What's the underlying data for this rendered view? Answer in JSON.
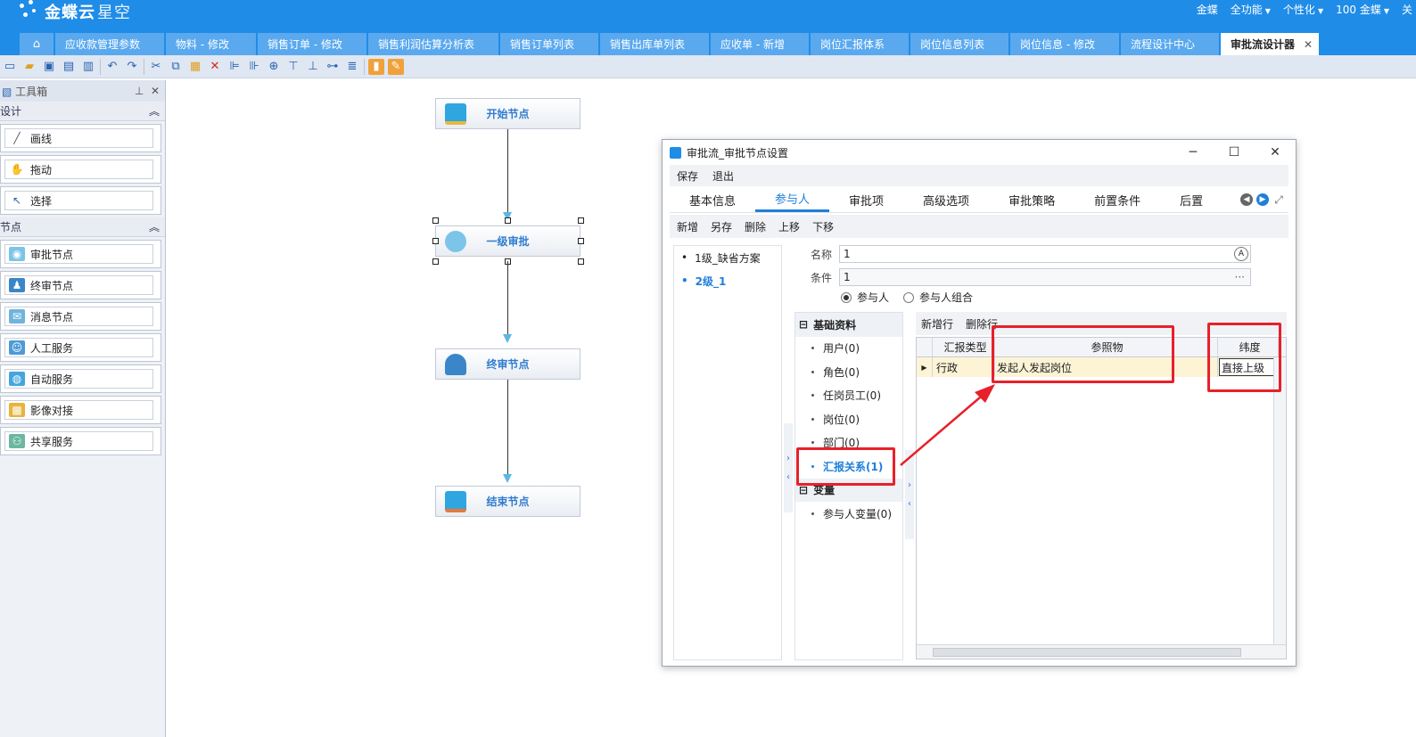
{
  "header": {
    "logo_text": "金蝶云",
    "logo_sub": "星空",
    "right_items": [
      "金蝶",
      "全功能",
      "个性化",
      "100  金蝶",
      "关"
    ]
  },
  "tabs": [
    {
      "label": "应收款管理参数"
    },
    {
      "label": "物料 - 修改"
    },
    {
      "label": "销售订单 - 修改"
    },
    {
      "label": "销售利润估算分析表"
    },
    {
      "label": "销售订单列表"
    },
    {
      "label": "销售出库单列表"
    },
    {
      "label": "应收单 - 新增"
    },
    {
      "label": "岗位汇报体系"
    },
    {
      "label": "岗位信息列表"
    },
    {
      "label": "岗位信息 - 修改"
    },
    {
      "label": "流程设计中心"
    },
    {
      "label": "审批流设计器"
    }
  ],
  "toolbox": {
    "title": "工具箱",
    "section_design": "设计",
    "design_items": [
      "画线",
      "拖动",
      "选择"
    ],
    "section_nodes": "节点",
    "node_items": [
      "审批节点",
      "终审节点",
      "消息节点",
      "人工服务",
      "自动服务",
      "影像对接",
      "共享服务"
    ]
  },
  "flow": {
    "start": "开始节点",
    "approve": "一级审批",
    "final": "终审节点",
    "end": "结束节点"
  },
  "dialog": {
    "title": "审批流_审批节点设置",
    "menu": [
      "保存",
      "退出"
    ],
    "tabs": [
      "基本信息",
      "参与人",
      "审批项",
      "高级选项",
      "审批策略",
      "前置条件",
      "后置"
    ],
    "actions": [
      "新增",
      "另存",
      "删除",
      "上移",
      "下移"
    ],
    "list": [
      "1级_缺省方案",
      "2级_1"
    ],
    "name_label": "名称",
    "name_value": "1",
    "cond_label": "条件",
    "cond_value": "1",
    "radio_participant": "参与人",
    "radio_combo": "参与人组合",
    "tree": {
      "group_basic": "基础资料",
      "items": [
        "用户(0)",
        "角色(0)",
        "任岗员工(0)",
        "岗位(0)",
        "部门(0)"
      ],
      "report": "汇报关系(1)",
      "group_var": "变量",
      "var_item": "参与人变量(0)"
    },
    "grid_actions": [
      "新增行",
      "删除行"
    ],
    "grid_headers": [
      "汇报类型",
      "参照物",
      "纬度"
    ],
    "grid_row": [
      "行政",
      "发起人发起岗位",
      "直接上级"
    ]
  }
}
